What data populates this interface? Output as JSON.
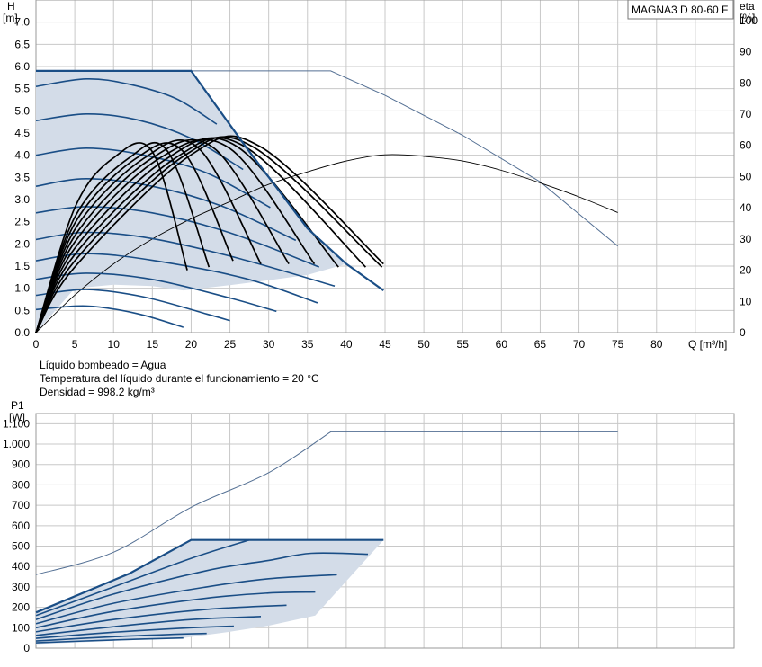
{
  "model": "MAGNA3 D 80-60 F",
  "info": [
    "Líquido bombeado = Agua",
    "Temperatura del líquido durante el funcionamiento = 20 °C",
    "Densidad = 998.2 kg/m³"
  ],
  "colors": {
    "area_fill": "#d3dce8",
    "curve": "#1a4e86",
    "efficiency": "#000000",
    "twin_pump": "#536f93"
  },
  "chart_data": [
    {
      "type": "line",
      "title": "",
      "xlabel": "Q [m³/h]",
      "ylabel_name": "H",
      "ylabel_unit": "[m]",
      "y2label_name": "eta",
      "y2label_unit": "[%]",
      "xlim": [
        0,
        90
      ],
      "ylim": [
        0,
        7.5
      ],
      "y2lim": [
        0,
        106.6
      ],
      "grid": true,
      "x_ticks": [
        "0",
        "5",
        "10",
        "15",
        "20",
        "25",
        "30",
        "35",
        "40",
        "45",
        "50",
        "55",
        "60",
        "65",
        "70",
        "75",
        "80"
      ],
      "y_ticks": [
        "0.0",
        "0.5",
        "1.0",
        "1.5",
        "2.0",
        "2.5",
        "3.0",
        "3.5",
        "4.0",
        "4.5",
        "5.0",
        "5.5",
        "6.0",
        "6.5",
        "7.0"
      ],
      "y2_ticks": [
        "0",
        "10",
        "20",
        "30",
        "40",
        "50",
        "60",
        "70",
        "80",
        "90",
        "100"
      ],
      "series": [
        {
          "role": "twin-pump-max-head",
          "values": [
            [
              0,
              5.9
            ],
            [
              38,
              5.9
            ],
            [
              45,
              5.35
            ],
            [
              55,
              4.45
            ],
            [
              65,
              3.4
            ],
            [
              75,
              1.95
            ]
          ]
        },
        {
          "role": "efficiency-envelope",
          "axis": "y2",
          "values": [
            [
              0,
              0
            ],
            [
              5,
              12
            ],
            [
              10,
              22
            ],
            [
              15,
              30
            ],
            [
              20,
              36.5
            ],
            [
              25,
              42
            ],
            [
              30,
              47.5
            ],
            [
              35,
              51.5
            ],
            [
              40,
              55
            ],
            [
              45,
              57
            ],
            [
              50,
              56.5
            ],
            [
              55,
              55
            ],
            [
              60,
              52
            ],
            [
              65,
              48
            ],
            [
              70,
              43.5
            ],
            [
              75,
              38.5
            ]
          ]
        },
        {
          "role": "max-head-envelope",
          "values": [
            [
              0,
              5.9
            ],
            [
              20,
              5.9
            ],
            [
              27,
              4.2
            ],
            [
              35,
              2.35
            ],
            [
              40,
              1.55
            ],
            [
              44.8,
              0.95
            ]
          ]
        },
        {
          "role": "min-curve",
          "values": [
            [
              0,
              0
            ],
            [
              5,
              1.0
            ],
            [
              10,
              1.08
            ],
            [
              15,
              1.05
            ],
            [
              19,
              0.95
            ],
            [
              25,
              1.07
            ],
            [
              30,
              1.18
            ],
            [
              35,
              1.3
            ],
            [
              40,
              1.55
            ],
            [
              44.8,
              0.95
            ]
          ]
        },
        {
          "role": "speed-curve",
          "values": [
            [
              0,
              5.55
            ],
            [
              6.5,
              5.72
            ],
            [
              12,
              5.6
            ],
            [
              18,
              5.28
            ],
            [
              23.3,
              4.7
            ]
          ]
        },
        {
          "role": "speed-curve",
          "values": [
            [
              0,
              4.78
            ],
            [
              6.5,
              4.93
            ],
            [
              13,
              4.8
            ],
            [
              20,
              4.38
            ],
            [
              26.7,
              3.68
            ]
          ]
        },
        {
          "role": "speed-curve",
          "values": [
            [
              0,
              4.0
            ],
            [
              6.5,
              4.16
            ],
            [
              14,
              4.0
            ],
            [
              22,
              3.6
            ],
            [
              30.2,
              2.82
            ]
          ]
        },
        {
          "role": "speed-curve",
          "values": [
            [
              0,
              3.3
            ],
            [
              6.5,
              3.47
            ],
            [
              15,
              3.3
            ],
            [
              24,
              2.85
            ],
            [
              33.5,
              2.08
            ]
          ]
        },
        {
          "role": "speed-curve",
          "values": [
            [
              0,
              2.7
            ],
            [
              6.5,
              2.84
            ],
            [
              15,
              2.7
            ],
            [
              25,
              2.25
            ],
            [
              36.5,
              1.48
            ]
          ]
        },
        {
          "role": "speed-curve",
          "values": [
            [
              0,
              2.1
            ],
            [
              6.5,
              2.26
            ],
            [
              15,
              2.12
            ],
            [
              26,
              1.68
            ],
            [
              38.5,
              1.05
            ]
          ]
        },
        {
          "role": "speed-curve",
          "values": [
            [
              0,
              1.62
            ],
            [
              6.5,
              1.78
            ],
            [
              15,
              1.63
            ],
            [
              27,
              1.22
            ],
            [
              36.3,
              0.67
            ]
          ]
        },
        {
          "role": "speed-curve",
          "values": [
            [
              0,
              1.2
            ],
            [
              6.5,
              1.34
            ],
            [
              15,
              1.2
            ],
            [
              25,
              0.78
            ],
            [
              31,
              0.48
            ]
          ]
        },
        {
          "role": "speed-curve",
          "values": [
            [
              0,
              0.84
            ],
            [
              6.5,
              0.97
            ],
            [
              14,
              0.8
            ],
            [
              22,
              0.42
            ],
            [
              25,
              0.27
            ]
          ]
        },
        {
          "role": "speed-curve",
          "values": [
            [
              0,
              0.52
            ],
            [
              6.5,
              0.6
            ],
            [
              13,
              0.43
            ],
            [
              19,
              0.12
            ]
          ]
        },
        {
          "role": "eff-curve",
          "axis": "y2",
          "values": [
            [
              0,
              0
            ],
            [
              5,
              40
            ],
            [
              10,
              56
            ],
            [
              15,
              58
            ],
            [
              19.5,
              20
            ]
          ]
        },
        {
          "role": "eff-curve",
          "axis": "y2",
          "values": [
            [
              0,
              0
            ],
            [
              5,
              37
            ],
            [
              12,
              56
            ],
            [
              17,
              58
            ],
            [
              22.3,
              21
            ]
          ]
        },
        {
          "role": "eff-curve",
          "axis": "y2",
          "values": [
            [
              0,
              0
            ],
            [
              5,
              35
            ],
            [
              13,
              56
            ],
            [
              19,
              58
            ],
            [
              25.4,
              23
            ]
          ]
        },
        {
          "role": "eff-curve",
          "axis": "y2",
          "values": [
            [
              0,
              0
            ],
            [
              5,
              33
            ],
            [
              14,
              56
            ],
            [
              21,
              59
            ],
            [
              29,
              22
            ]
          ]
        },
        {
          "role": "eff-curve",
          "axis": "y2",
          "values": [
            [
              0,
              0
            ],
            [
              5,
              31
            ],
            [
              15,
              56
            ],
            [
              23,
              59
            ],
            [
              32.6,
              22
            ]
          ]
        },
        {
          "role": "eff-curve",
          "axis": "y2",
          "values": [
            [
              0,
              0
            ],
            [
              5,
              29
            ],
            [
              16,
              56
            ],
            [
              25,
              59
            ],
            [
              35.9,
              22
            ]
          ]
        },
        {
          "role": "eff-curve",
          "axis": "y2",
          "values": [
            [
              0,
              0
            ],
            [
              5,
              27
            ],
            [
              17,
              56
            ],
            [
              26,
              59.5
            ],
            [
              39,
              21
            ]
          ]
        },
        {
          "role": "eff-curve",
          "axis": "y2",
          "values": [
            [
              0,
              0
            ],
            [
              5,
              25
            ],
            [
              18,
              56
            ],
            [
              27,
              59.5
            ],
            [
              42.5,
              21
            ]
          ]
        },
        {
          "role": "eff-curve",
          "axis": "y2",
          "values": [
            [
              0,
              0
            ],
            [
              5,
              23
            ],
            [
              19,
              56.5
            ],
            [
              28,
              59.5
            ],
            [
              44.6,
              21
            ]
          ]
        },
        {
          "role": "eff-curve",
          "axis": "y2",
          "values": [
            [
              0,
              0
            ],
            [
              5,
              21
            ],
            [
              20,
              57
            ],
            [
              29,
              59.5
            ],
            [
              44.8,
              22
            ]
          ]
        }
      ]
    },
    {
      "type": "line",
      "title": "",
      "xlabel": "",
      "ylabel_name": "P1",
      "ylabel_unit": "[W]",
      "xlim": [
        0,
        90
      ],
      "ylim": [
        0,
        1150
      ],
      "grid": true,
      "y_ticks": [
        "0",
        "100",
        "200",
        "300",
        "400",
        "500",
        "600",
        "700",
        "800",
        "900",
        "1.000",
        "1.100"
      ],
      "series": [
        {
          "role": "twin-pump-max-power",
          "values": [
            [
              0,
              360
            ],
            [
              10,
              470
            ],
            [
              20,
              690
            ],
            [
              30,
              860
            ],
            [
              38,
              1060
            ],
            [
              75,
              1060
            ]
          ]
        },
        {
          "role": "max-power-envelope",
          "values": [
            [
              0,
              175
            ],
            [
              12,
              365
            ],
            [
              20,
              530
            ],
            [
              44.8,
              530
            ]
          ]
        },
        {
          "role": "min-power",
          "values": [
            [
              0,
              20
            ],
            [
              19,
              50
            ],
            [
              25,
              80
            ],
            [
              30,
              110
            ],
            [
              36,
              160
            ],
            [
              44.8,
              530
            ]
          ]
        },
        {
          "role": "power-curve",
          "values": [
            [
              0,
              160
            ],
            [
              10,
              300
            ],
            [
              20,
              440
            ],
            [
              27.5,
              530
            ]
          ]
        },
        {
          "role": "power-curve",
          "values": [
            [
              0,
              140
            ],
            [
              10,
              265
            ],
            [
              22,
              380
            ],
            [
              30,
              430
            ],
            [
              35.5,
              465
            ],
            [
              42.8,
              460
            ]
          ]
        },
        {
          "role": "power-curve",
          "values": [
            [
              0,
              120
            ],
            [
              10,
              220
            ],
            [
              22,
              300
            ],
            [
              30,
              340
            ],
            [
              38.8,
              360
            ]
          ]
        },
        {
          "role": "power-curve",
          "values": [
            [
              0,
              100
            ],
            [
              10,
              180
            ],
            [
              22,
              245
            ],
            [
              30,
              270
            ],
            [
              36,
              275
            ]
          ]
        },
        {
          "role": "power-curve",
          "values": [
            [
              0,
              80
            ],
            [
              10,
              140
            ],
            [
              22,
              190
            ],
            [
              32.3,
              210
            ]
          ]
        },
        {
          "role": "power-curve",
          "values": [
            [
              0,
              62
            ],
            [
              10,
              105
            ],
            [
              20,
              140
            ],
            [
              29,
              155
            ]
          ]
        },
        {
          "role": "power-curve",
          "values": [
            [
              0,
              48
            ],
            [
              10,
              78
            ],
            [
              20,
              100
            ],
            [
              25.5,
              108
            ]
          ]
        },
        {
          "role": "power-curve",
          "values": [
            [
              0,
              35
            ],
            [
              10,
              56
            ],
            [
              18,
              68
            ],
            [
              22,
              72
            ]
          ]
        },
        {
          "role": "power-curve",
          "values": [
            [
              0,
              26
            ],
            [
              10,
              40
            ],
            [
              19,
              50
            ]
          ]
        }
      ]
    }
  ]
}
